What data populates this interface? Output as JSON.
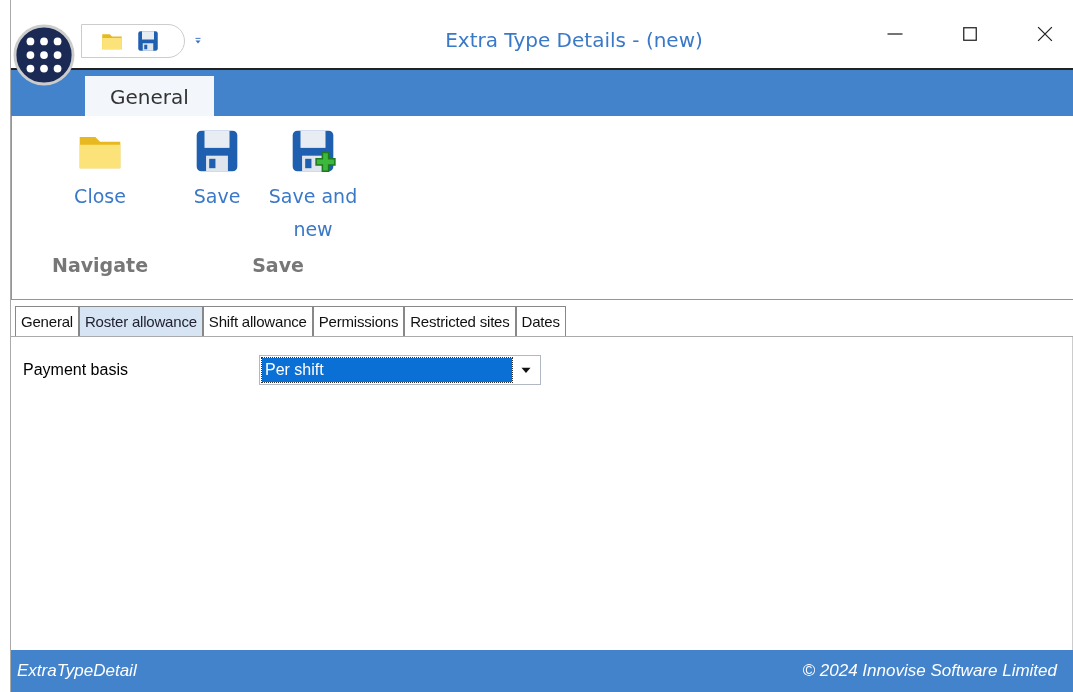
{
  "window": {
    "title": "Extra Type Details - (new)"
  },
  "ribbon": {
    "tabs": [
      {
        "label": "General",
        "selected": true
      }
    ],
    "groups": [
      {
        "label": "Navigate",
        "buttons": [
          {
            "label": "Close",
            "kind": "folder"
          }
        ]
      },
      {
        "label": "Save",
        "buttons": [
          {
            "label": "Save",
            "kind": "save"
          },
          {
            "label": "Save and new",
            "kind": "save-new"
          }
        ]
      }
    ]
  },
  "tabs": [
    {
      "label": "General",
      "selected": false
    },
    {
      "label": "Roster allowance",
      "selected": true
    },
    {
      "label": "Shift allowance",
      "selected": false
    },
    {
      "label": "Permissions",
      "selected": false
    },
    {
      "label": "Restricted sites",
      "selected": false
    },
    {
      "label": "Dates",
      "selected": false
    }
  ],
  "form": {
    "label": "Payment basis",
    "value": "Per shift"
  },
  "status_bar": {
    "left": "ExtraTypeDetail",
    "right": "© 2024 Innovise Software Limited"
  }
}
